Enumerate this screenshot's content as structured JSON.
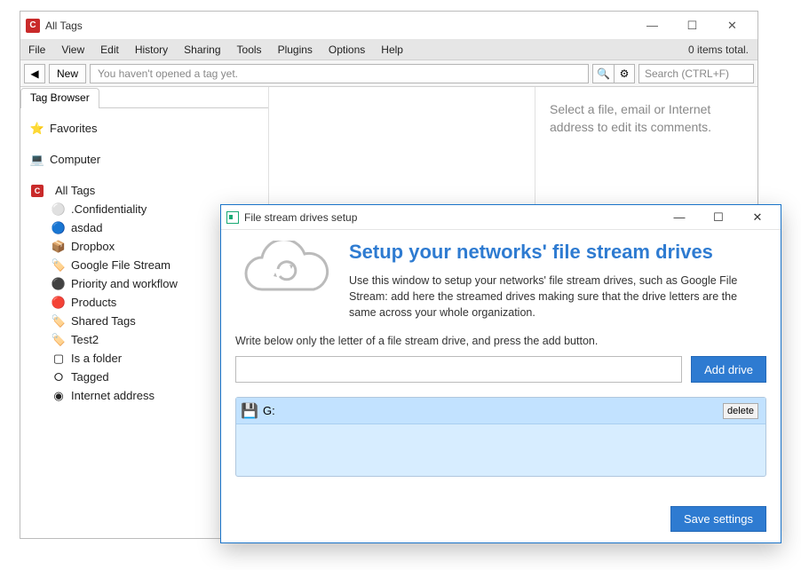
{
  "window": {
    "title": "All Tags",
    "app_icon_letter": "C"
  },
  "menu": [
    "File",
    "View",
    "Edit",
    "History",
    "Sharing",
    "Tools",
    "Plugins",
    "Options",
    "Help"
  ],
  "items_total": "0 items total.",
  "toolbar": {
    "back_glyph": "◀",
    "new": "New",
    "tagbar_placeholder": "You haven't opened a tag yet.",
    "search_icon": "🔍",
    "gear_icon": "⚙",
    "search_placeholder": "Search (CTRL+F)"
  },
  "sidebar": {
    "tab": "Tag Browser",
    "favorites": "Favorites",
    "computer": "Computer",
    "all_tags": "All Tags",
    "children": [
      ".Confidentiality",
      "asdad",
      "Dropbox",
      "Google File Stream",
      "Priority and workflow",
      "Products",
      "Shared Tags",
      "Test2",
      "Is a folder",
      "Tagged",
      "Internet address"
    ]
  },
  "hint": "Select a file, email or Internet address to edit its comments.",
  "modal": {
    "title": "File stream drives setup",
    "heading": "Setup your networks' file stream drives",
    "desc": "Use this window to setup your networks' file stream drives, such as Google File Stream: add here the streamed drives making sure that the drive letters  are the same across your whole organization.",
    "instruction": "Write below only the letter of a file stream drive, and press the add button.",
    "add_btn": "Add drive",
    "drives": [
      {
        "icon": "💾",
        "label": "G:",
        "delete": "delete"
      }
    ],
    "save": "Save settings"
  },
  "sysbtns": {
    "min": "—",
    "max": "☐",
    "close": "✕"
  }
}
